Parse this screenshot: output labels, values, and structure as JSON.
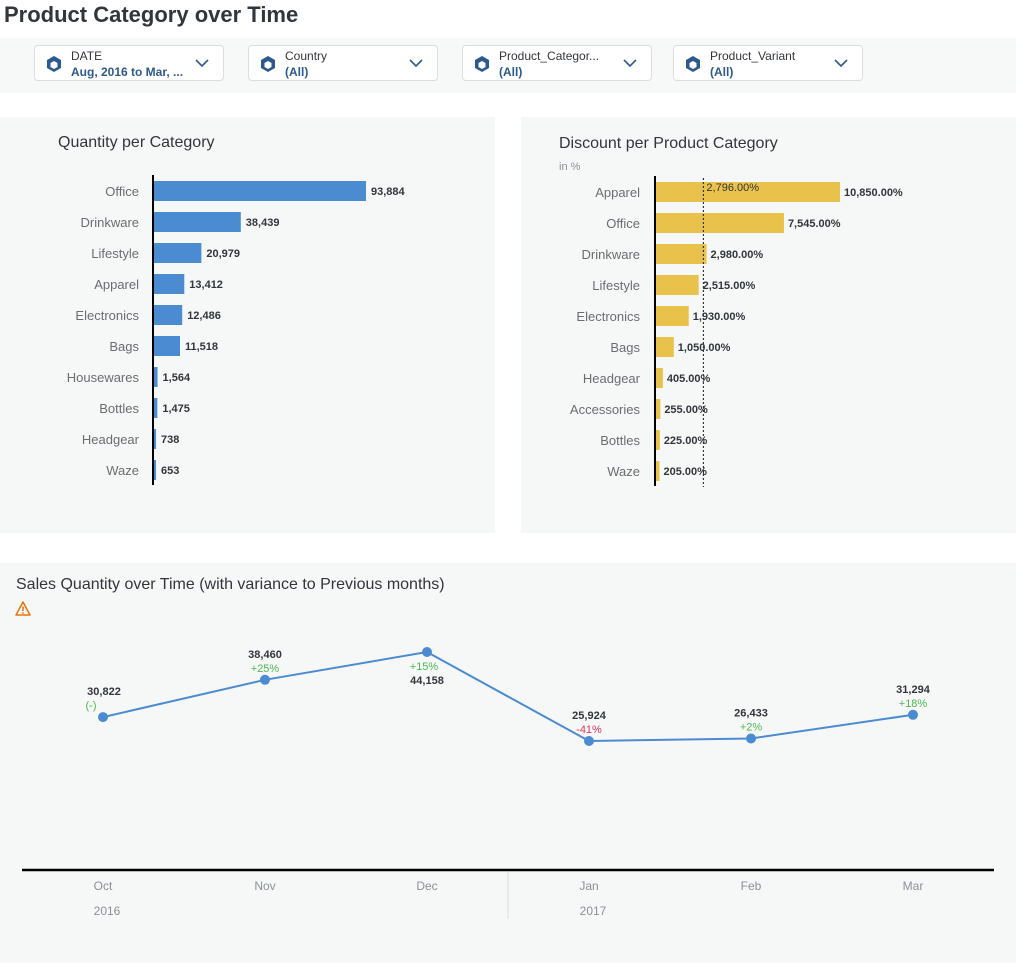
{
  "page": {
    "title": "Product Category over Time"
  },
  "filters": [
    {
      "label": "DATE",
      "value": "Aug, 2016 to Mar, ...",
      "icon": "cube-icon"
    },
    {
      "label": "Country",
      "value": "(All)",
      "icon": "cube-icon"
    },
    {
      "label": "Product_Categor...",
      "value": "(All)",
      "icon": "cube-icon"
    },
    {
      "label": "Product_Variant",
      "value": "(All)",
      "icon": "cube-icon"
    }
  ],
  "colors": {
    "blue_bar": "#4a8bd1",
    "gold_bar": "#e8c24b",
    "line": "#4a8bd1",
    "positive": "#4cb94c",
    "negative": "#e0345c",
    "warning": "#e9730c"
  },
  "chart_data": [
    {
      "type": "bar",
      "orientation": "horizontal",
      "title": "Quantity per Category",
      "categories": [
        "Office",
        "Drinkware",
        "Lifestyle",
        "Apparel",
        "Electronics",
        "Bags",
        "Housewares",
        "Bottles",
        "Headgear",
        "Waze"
      ],
      "values": [
        93884,
        38439,
        20979,
        13412,
        12486,
        11518,
        1564,
        1475,
        738,
        653
      ],
      "value_labels": [
        "93,884",
        "38,439",
        "20,979",
        "13,412",
        "12,486",
        "11,518",
        "1,564",
        "1,475",
        "738",
        "653"
      ]
    },
    {
      "type": "bar",
      "orientation": "horizontal",
      "title": "Discount per Product Category",
      "subtitle": "in %",
      "categories": [
        "Apparel",
        "Office",
        "Drinkware",
        "Lifestyle",
        "Electronics",
        "Bags",
        "Headgear",
        "Accessories",
        "Bottles",
        "Waze"
      ],
      "values": [
        10850,
        7545,
        2980,
        2515,
        1930,
        1050,
        405,
        255,
        225,
        205
      ],
      "value_labels": [
        "10,850.00%",
        "7,545.00%",
        "2,980.00%",
        "2,515.00%",
        "1,930.00%",
        "1,050.00%",
        "405.00%",
        "255.00%",
        "225.00%",
        "205.00%"
      ],
      "reference_line": {
        "value": 2796,
        "label": "2,796.00%"
      }
    },
    {
      "type": "line",
      "title": "Sales Quantity over Time (with variance to Previous months)",
      "x": [
        "Oct",
        "Nov",
        "Dec",
        "Jan",
        "Feb",
        "Mar"
      ],
      "year_labels": [
        "2016",
        "2017"
      ],
      "values": [
        30822,
        38460,
        44158,
        25924,
        26433,
        31294
      ],
      "value_labels": [
        "30,822",
        "38,460",
        "44,158",
        "25,924",
        "26,433",
        "31,294"
      ],
      "variance": [
        "(-)",
        "+25%",
        "+15%",
        "-41%",
        "+2%",
        "+18%"
      ],
      "variance_sign": [
        "pos",
        "pos",
        "pos",
        "neg",
        "pos",
        "pos"
      ]
    }
  ]
}
